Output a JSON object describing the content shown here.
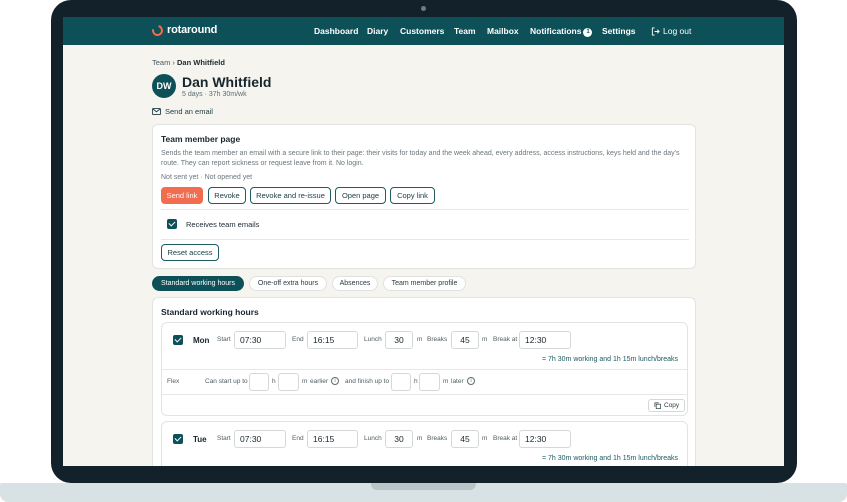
{
  "app": {
    "logo_text": "rotaround",
    "nav": [
      "Dashboard",
      "Diary",
      "Customers",
      "Team",
      "Mailbox",
      "Notifications",
      "Settings"
    ],
    "notifications_count": "1",
    "logout_label": "Log out"
  },
  "breadcrumb": {
    "parent": "Team",
    "separator": " › ",
    "current": "Dan Whitfield"
  },
  "member": {
    "initials": "DW",
    "name": "Dan Whitfield",
    "subtitle": "5 days · 37h 30m/wk",
    "send_email_label": "Send an email"
  },
  "member_page": {
    "title": "Team member page",
    "description": "Sends the team member an email with a secure link to their page: their visits for today and the week ahead, every address, access instructions, keys held and the day's route. They can report sickness or request leave from it. No login.",
    "status": "Not sent yet · Not opened yet",
    "buttons": {
      "send_link": "Send link",
      "revoke": "Revoke",
      "revoke_reissue": "Revoke and re-issue",
      "open_page": "Open page",
      "copy_link": "Copy link"
    },
    "receives_emails_label": "Receives team emails",
    "receives_emails_checked": true,
    "reset_access_label": "Reset access"
  },
  "tabs": [
    "Standard working hours",
    "One-off extra hours",
    "Absences",
    "Team member profile"
  ],
  "active_tab": "Standard working hours",
  "working_hours": {
    "title": "Standard working hours",
    "labels": {
      "start": "Start",
      "end": "End",
      "lunch": "Lunch",
      "breaks": "Breaks",
      "break_at": "Break at",
      "minutes": "m",
      "flex": "Flex",
      "can_start_up_to": "Can start up to",
      "hours": "h",
      "earlier": "earlier",
      "and_finish_up_to": "and finish up to",
      "later": "later",
      "copy": "Copy"
    },
    "days": [
      {
        "day": "Mon",
        "start": "07:30",
        "end": "16:15",
        "lunch": "30",
        "breaks": "45",
        "break_at": "12:30",
        "summary": "= 7h 30m working and 1h 15m lunch/breaks"
      },
      {
        "day": "Tue",
        "start": "07:30",
        "end": "16:15",
        "lunch": "30",
        "breaks": "45",
        "break_at": "12:30",
        "summary": "= 7h 30m working and 1h 15m lunch/breaks"
      }
    ]
  }
}
